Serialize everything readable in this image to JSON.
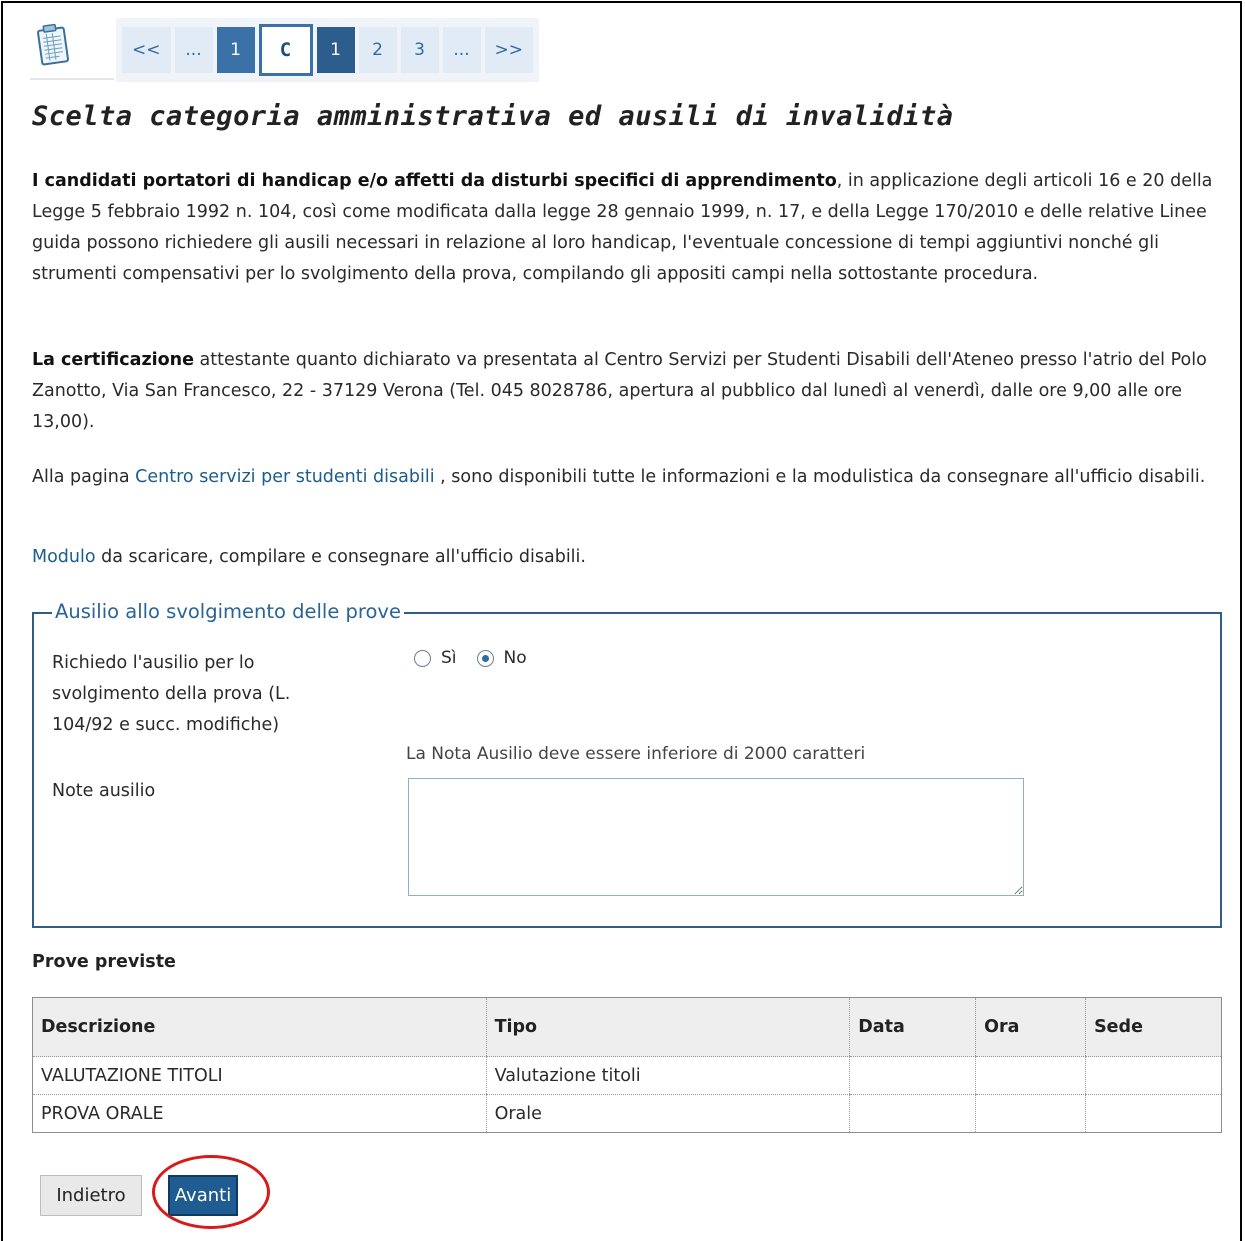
{
  "pager": {
    "first": "<<",
    "ellipsis_left": "...",
    "prev_page": "1",
    "current_step": "C",
    "page_current": "1",
    "page_2": "2",
    "page_3": "3",
    "ellipsis_right": "...",
    "last": ">>"
  },
  "page_title": "Scelta categoria amministrativa ed ausili di invalidità",
  "intro": {
    "bold": "I candidati portatori di handicap e/o affetti da disturbi specifici di apprendimento",
    "text": ", in applicazione degli articoli 16 e 20 della Legge 5 febbraio 1992 n. 104, così come modificata dalla legge 28 gennaio 1999, n. 17, e della Legge 170/2010 e delle relative Linee guida possono richiedere gli ausili necessari in relazione al loro handicap, l'eventuale concessione di tempi aggiuntivi nonché gli strumenti compensativi per lo svolgimento della prova, compilando gli appositi campi nella sottostante procedura."
  },
  "certification": {
    "bold": "La certificazione",
    "text": " attestante quanto dichiarato va presentata al Centro Servizi per Studenti Disabili dell'Ateneo presso l'atrio del Polo Zanotto, Via San Francesco, 22 - 37129 Verona (Tel. 045 8028786, apertura al pubblico dal lunedì al venerdì, dalle ore 9,00 alle ore 13,00)."
  },
  "info": {
    "prefix": "Alla pagina ",
    "link": "Centro servizi per studenti disabili",
    "suffix": " , sono disponibili tutte le informazioni e la modulistica da consegnare all'ufficio disabili."
  },
  "modulo": {
    "link": "Modulo",
    "text": " da scaricare, compilare e consegnare all'ufficio disabili."
  },
  "fieldset": {
    "legend": "Ausilio allo svolgimento delle prove",
    "request_label": "Richiedo l'ausilio per lo svolgimento della prova (L. 104/92 e succ. modifiche)",
    "option_yes": "Sì",
    "option_no": "No",
    "selected": "No",
    "hint": "La Nota Ausilio deve essere inferiore di 2000 caratteri",
    "notes_label": "Note ausilio",
    "notes_value": ""
  },
  "exams": {
    "title": "Prove previste",
    "headers": [
      "Descrizione",
      "Tipo",
      "Data",
      "Ora",
      "Sede"
    ],
    "rows": [
      [
        "VALUTAZIONE TITOLI",
        "Valutazione titoli",
        "",
        "",
        ""
      ],
      [
        "PROVA ORALE",
        "Orale",
        "",
        "",
        ""
      ]
    ]
  },
  "buttons": {
    "back": "Indietro",
    "next": "Avanti"
  },
  "colors": {
    "accent": "#2f5d86",
    "highlight_ring": "#d51b1b",
    "link": "#1b5d8c"
  },
  "icons": {
    "step": "clipboard-form-icon"
  }
}
